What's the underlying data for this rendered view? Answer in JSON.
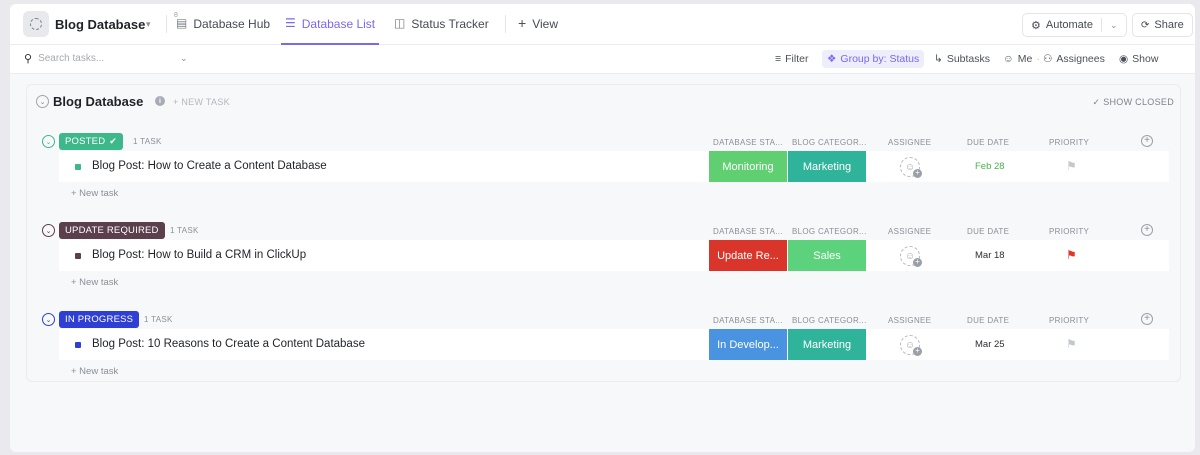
{
  "header": {
    "workspace_title": "Blog Database",
    "tabs": [
      {
        "label": "Database Hub",
        "badge": "8"
      },
      {
        "label": "Database List"
      },
      {
        "label": "Status Tracker"
      },
      {
        "label": "View"
      }
    ],
    "automate_label": "Automate",
    "share_label": "Share"
  },
  "toolbar": {
    "search_placeholder": "Search tasks...",
    "filter_label": "Filter",
    "group_by_label": "Group by: Status",
    "subtasks_label": "Subtasks",
    "me_label": "Me",
    "assignees_label": "Assignees",
    "show_label": "Show"
  },
  "list": {
    "title": "Blog Database",
    "new_task_label": "+ NEW TASK",
    "show_closed_label": "SHOW CLOSED",
    "columns": {
      "db_status": "DATABASE STA...",
      "blog_category": "BLOG CATEGOR...",
      "assignee": "ASSIGNEE",
      "due_date": "DUE DATE",
      "priority": "PRIORITY"
    },
    "row_new_task_label": "+ New task",
    "groups": [
      {
        "status": "POSTED",
        "status_color": "#3db88b",
        "count": "1 TASK",
        "task": {
          "name": "Blog Post: How to Create a Content Database",
          "db_status": "Monitoring",
          "db_status_color": "#5fcf72",
          "category": "Marketing",
          "category_color": "#2fb39a",
          "due": "Feb 28",
          "due_color": "#49b04f",
          "priority_color": "#c5c9cf"
        }
      },
      {
        "status": "UPDATE REQUIRED",
        "status_color": "#5b3f4c",
        "count": "1 TASK",
        "task": {
          "name": "Blog Post: How to Build a CRM in ClickUp",
          "db_status": "Update Re...",
          "db_status_color": "#d9352a",
          "category": "Sales",
          "category_color": "#5dd27c",
          "due": "Mar 18",
          "due_color": "#2a2e34",
          "priority_color": "#e0352d"
        }
      },
      {
        "status": "IN PROGRESS",
        "status_color": "#2f3fd4",
        "count": "1 TASK",
        "task": {
          "name": "Blog Post: 10 Reasons to Create a Content Database",
          "db_status": "In Develop...",
          "db_status_color": "#4a93e0",
          "category": "Marketing",
          "category_color": "#2fb39a",
          "due": "Mar 25",
          "due_color": "#2a2e34",
          "priority_color": "#c5c9cf"
        }
      }
    ]
  }
}
